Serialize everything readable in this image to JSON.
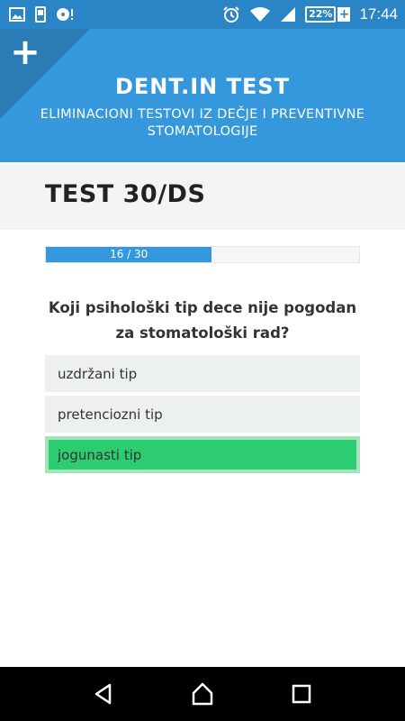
{
  "status_bar": {
    "battery_percent": "22%",
    "battery_plus": "+",
    "time": "17:44",
    "icons": [
      "image-icon",
      "phone-icon",
      "disc-icon",
      "alarm-icon",
      "wifi-icon",
      "signal-icon"
    ]
  },
  "header": {
    "corner_plus": "+",
    "title": "DENT.IN TEST",
    "subtitle": "ELIMINACIONI TESTOVI IZ DEČJE I PREVENTIVNE STOMATOLOGIJE"
  },
  "test": {
    "title": "TEST 30/DS"
  },
  "progress": {
    "label": "16 / 30",
    "current": 16,
    "total": 30,
    "fraction": 0.53
  },
  "question": {
    "text": "Koji psihološki tip dece nije pogodan za stomatološki rad?"
  },
  "answers": [
    {
      "label": "uzdržani tip",
      "state": "neutral"
    },
    {
      "label": "pretenciozni tip",
      "state": "neutral"
    },
    {
      "label": "jogunasti tip",
      "state": "correct"
    }
  ],
  "colors": {
    "header": "#3598dc",
    "status_bar": "#2a85c6",
    "correct": "#2ecc71",
    "answer_bg": "#ecf0f1"
  }
}
